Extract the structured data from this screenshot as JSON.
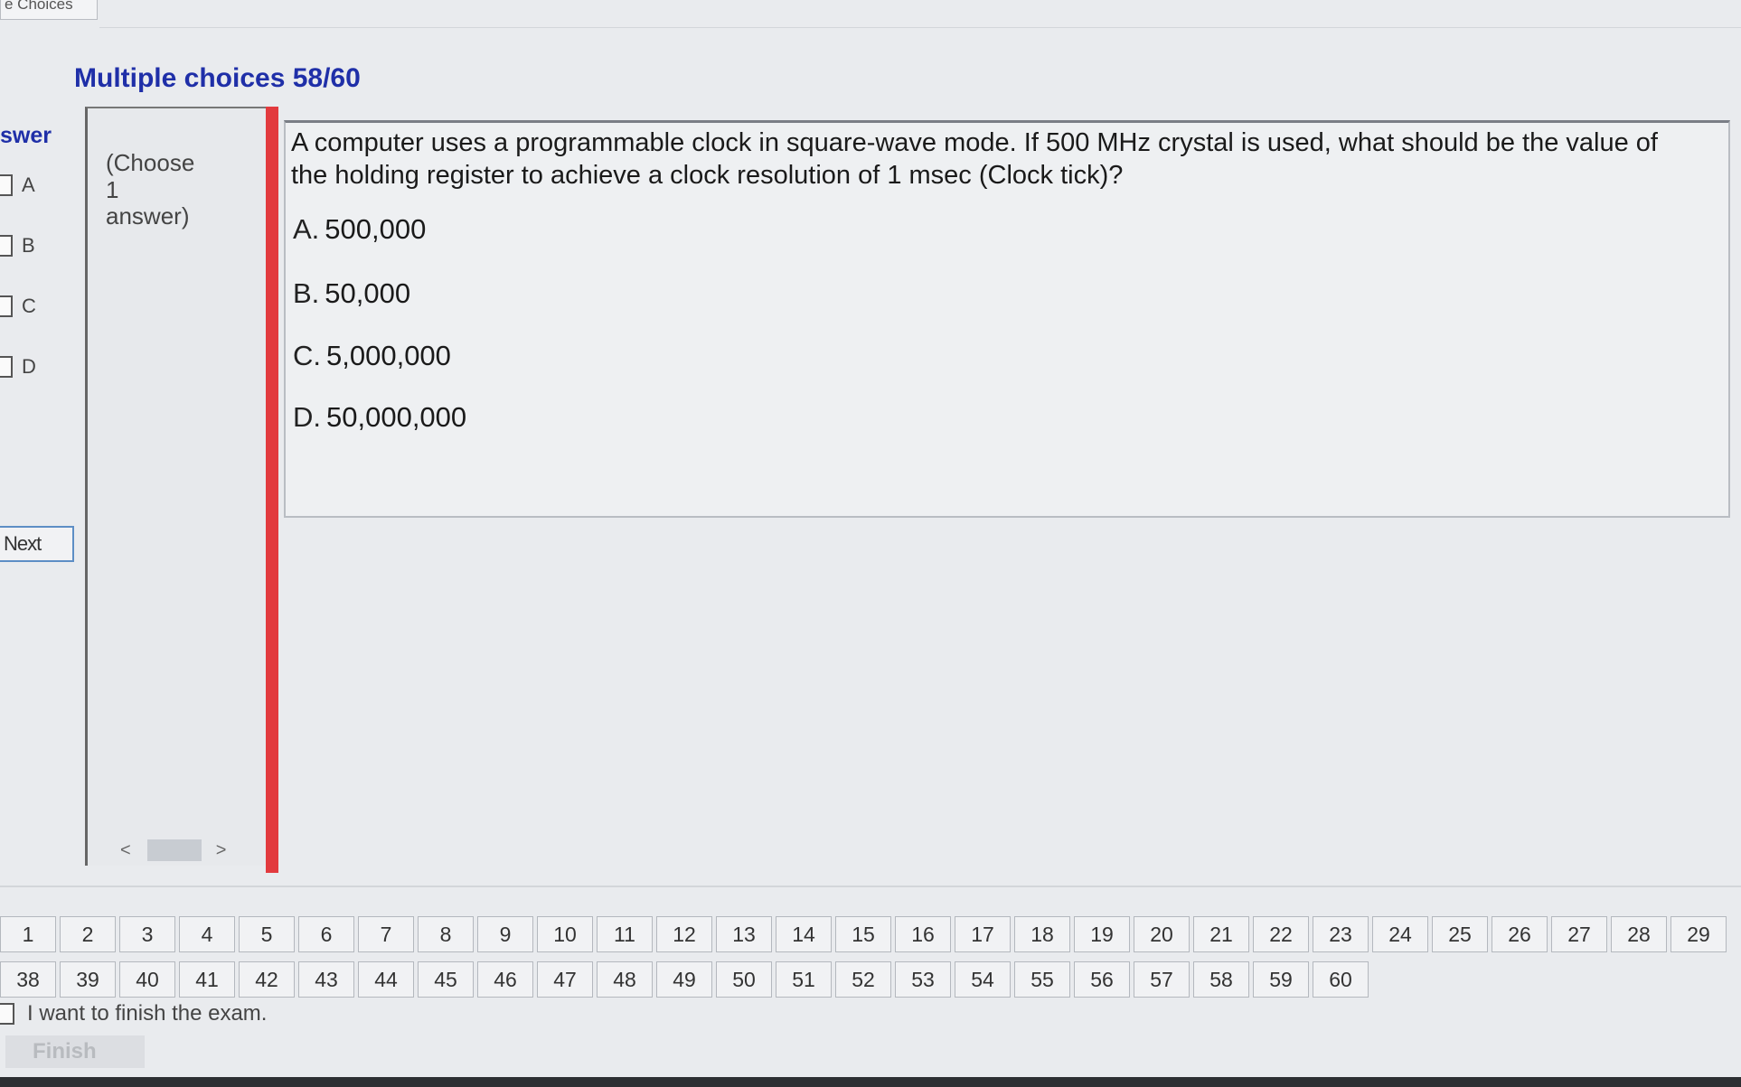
{
  "top_tab": {
    "label": "e Choices"
  },
  "section_title": "Multiple choices 58/60",
  "answer_column": {
    "header": "swer",
    "options": [
      "A",
      "B",
      "C",
      "D"
    ],
    "next_label": "Next"
  },
  "instruction": {
    "line1": "(Choose",
    "line2": "1",
    "line3": "answer)",
    "scroll_left": "<",
    "scroll_right": ">"
  },
  "question": {
    "text": "A computer uses a programmable clock in square-wave mode. If 500 MHz crystal is used, what should be the value of the holding register to achieve a clock resolution of 1 msec (Clock tick)?",
    "choices": [
      {
        "letter": "A.",
        "text": "500,000"
      },
      {
        "letter": "B.",
        "text": "50,000"
      },
      {
        "letter": "C.",
        "text": "5,000,000"
      },
      {
        "letter": "D.",
        "text": "50,000,000"
      }
    ]
  },
  "nav": {
    "row1": [
      "1",
      "2",
      "3",
      "4",
      "5",
      "6",
      "7",
      "8",
      "9",
      "10",
      "11",
      "12",
      "13",
      "14",
      "15",
      "16",
      "17",
      "18",
      "19",
      "20",
      "21",
      "22",
      "23",
      "24",
      "25",
      "26",
      "27",
      "28",
      "29"
    ],
    "row2": [
      "38",
      "39",
      "40",
      "41",
      "42",
      "43",
      "44",
      "45",
      "46",
      "47",
      "48",
      "49",
      "50",
      "51",
      "52",
      "53",
      "54",
      "55",
      "56",
      "57",
      "58",
      "59",
      "60"
    ]
  },
  "finish": {
    "checkbox_label": "I want to finish the exam.",
    "button_label": "Finish"
  }
}
